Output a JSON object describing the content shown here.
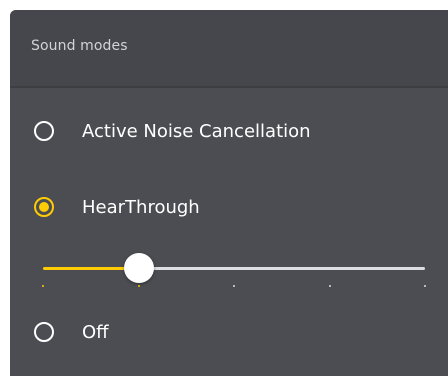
{
  "header": {
    "title": "Sound modes"
  },
  "options": [
    {
      "label": "Active Noise Cancellation",
      "selected": false
    },
    {
      "label": "HearThrough",
      "selected": true
    },
    {
      "label": "Off",
      "selected": false
    }
  ],
  "slider": {
    "value": 0.25,
    "steps": 5,
    "colors": {
      "active": "#ffcb05",
      "inactive": "#dcdde0"
    }
  },
  "colors": {
    "panel": "#4b4d52",
    "header": "#45474c",
    "accent": "#ffcb05",
    "text": "#ffffff"
  }
}
